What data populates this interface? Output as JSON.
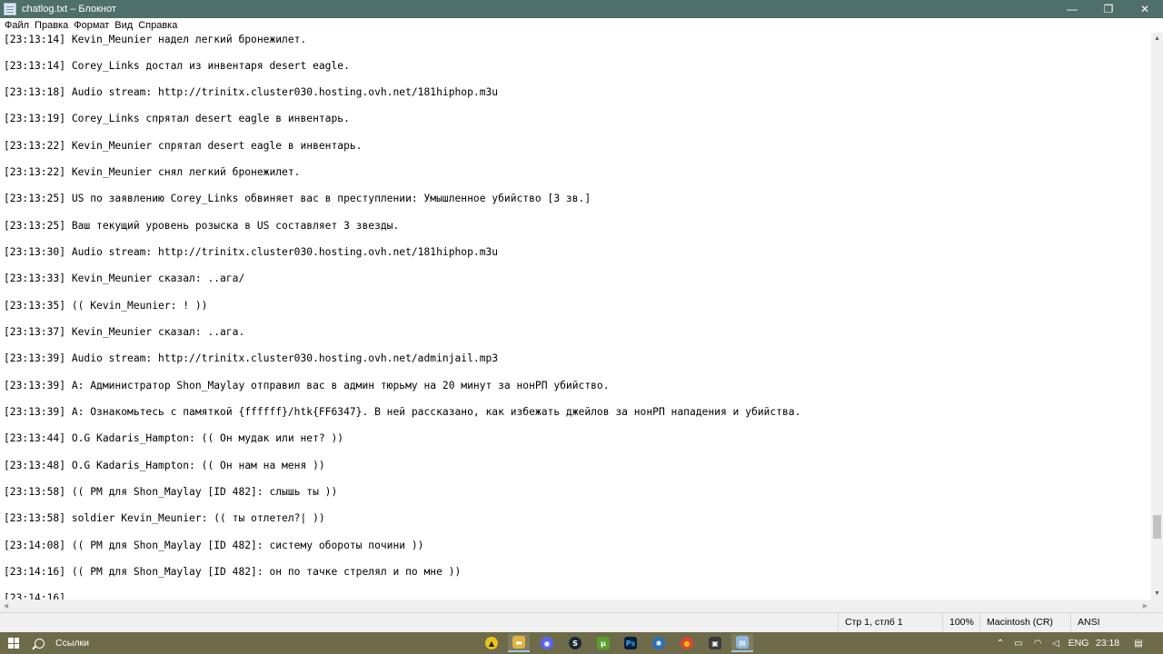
{
  "window": {
    "title": "chatlog.txt – Блокнот",
    "minimize_glyph": "—",
    "maximize_glyph": "❐",
    "close_glyph": "✕"
  },
  "menu": [
    "Файл",
    "Правка",
    "Формат",
    "Вид",
    "Справка"
  ],
  "lines": [
    "[23:13:14] Kevin_Meunier надел легкий бронежилет.",
    "[23:13:14] Corey_Links достал из инвентаря desert eagle.",
    "[23:13:18] Audio stream: http://trinitx.cluster030.hosting.ovh.net/181hiphop.m3u",
    "[23:13:19] Corey_Links спрятал desert eagle в инвентарь.",
    "[23:13:22] Kevin_Meunier спрятал desert eagle в инвентарь.",
    "[23:13:22] Kevin_Meunier снял легкий бронежилет.",
    "[23:13:25] US по заявлению Corey_Links обвиняет вас в преступлении: Умышленное убийство [3 зв.]",
    "[23:13:25] Ваш текущий уровень розыска в US составляет 3 звезды.",
    "[23:13:30] Audio stream: http://trinitx.cluster030.hosting.ovh.net/181hiphop.m3u",
    "[23:13:33] Kevin_Meunier сказал: ..ага/",
    "[23:13:35] (( Kevin_Meunier: ! ))",
    "[23:13:37] Kevin_Meunier сказал: ..ага.",
    "[23:13:39] Audio stream: http://trinitx.cluster030.hosting.ovh.net/adminjail.mp3",
    "[23:13:39] A: Администратор Shon_Maylay отправил вас в админ тюрьму на 20 минут за нонРП убийство.",
    "[23:13:39] A: Ознакомьтесь с памяткой {ffffff}/htk{FF6347}. В ней рассказано, как избежать джейлов за нонРП нападения и убийства.",
    "[23:13:44] O.G Kadaris_Hampton: (( Он мудак или нет? ))",
    "[23:13:48] O.G Kadaris_Hampton: (( Он нам на меня ))",
    "[23:13:58] (( PM для Shon_Maylay [ID 482]: слышь ты ))",
    "[23:13:58] soldier Kevin_Meunier: (( ты отлетел?| ))",
    "[23:14:08] (( PM для Shon_Maylay [ID 482]: систему обороты почини ))",
    "[23:14:16] (( PM для Shon_Maylay [ID 482]: он по тачке стрелял и по мне ))",
    "[23:14:16]"
  ],
  "status": {
    "position": "Стр 1, стлб 1",
    "zoom": "100%",
    "line_endings": "Macintosh (CR)",
    "encoding": "ANSI"
  },
  "taskbar": {
    "search_label": "Ссылки",
    "apps": [
      {
        "name": "app-yellow",
        "glyph": "▲",
        "color": "#e8c21f"
      },
      {
        "name": "file-explorer",
        "glyph": "▬",
        "color": "#e0b341"
      },
      {
        "name": "discord",
        "glyph": "◉",
        "color": "#5865f2"
      },
      {
        "name": "steam",
        "glyph": "S",
        "color": "#1b2838"
      },
      {
        "name": "utorrent",
        "glyph": "µ",
        "color": "#5a9e2f"
      },
      {
        "name": "photoshop",
        "glyph": "Ps",
        "color": "#0a1d3a"
      },
      {
        "name": "app-blue",
        "glyph": "✱",
        "color": "#2a6fb8"
      },
      {
        "name": "chrome",
        "glyph": "●",
        "color": "#db4437"
      },
      {
        "name": "game-app",
        "glyph": "▣",
        "color": "#3a3a3a"
      },
      {
        "name": "notepad",
        "glyph": "▤",
        "color": "#8fb7d8"
      }
    ],
    "language": "ENG",
    "time": "23:18"
  }
}
